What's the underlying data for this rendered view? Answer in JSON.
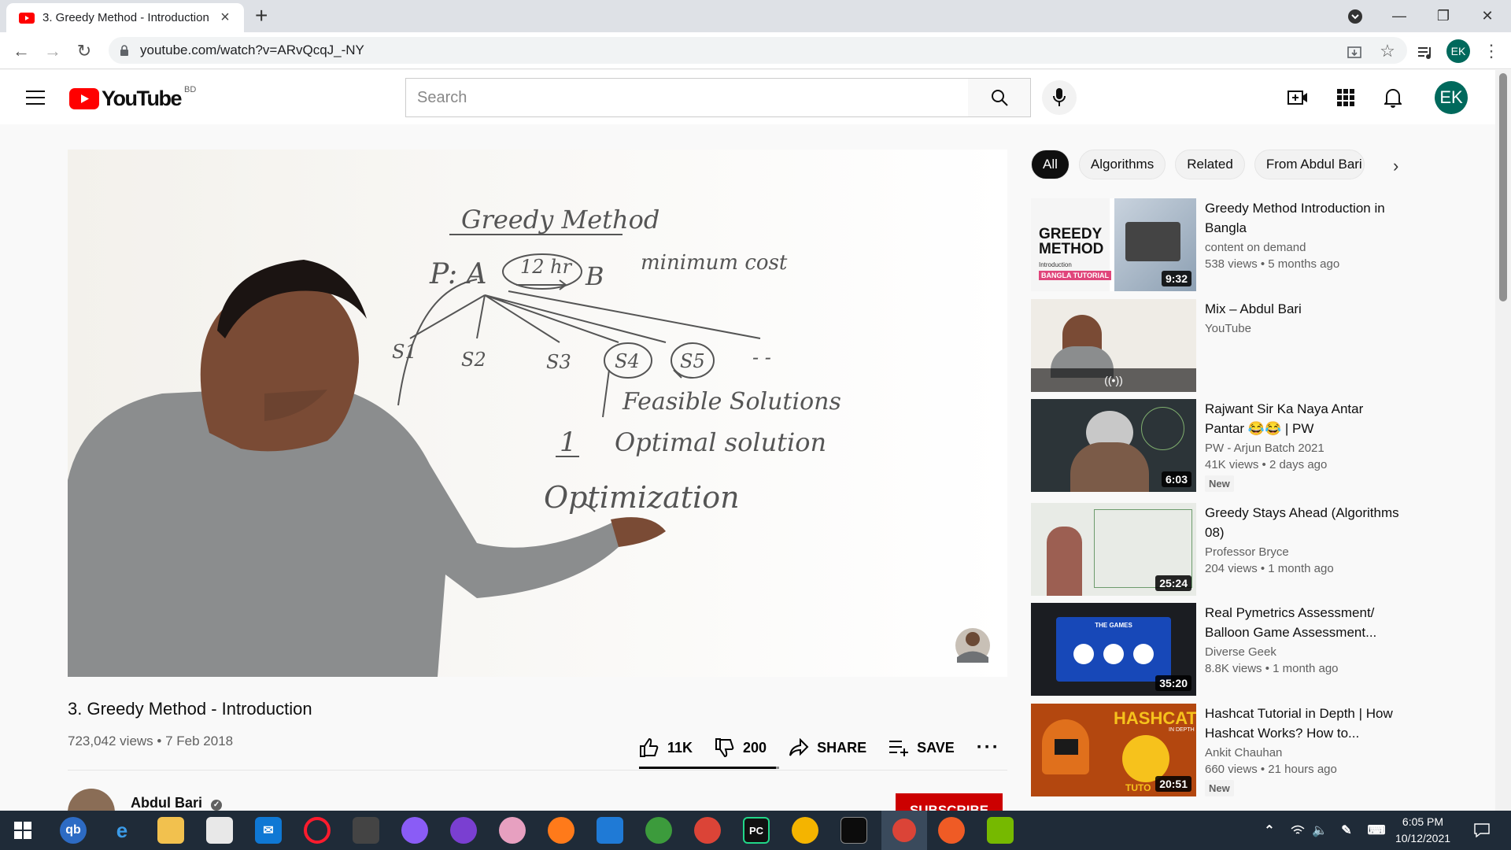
{
  "browser": {
    "tab_title": "3. Greedy Method - Introduction",
    "url": "youtube.com/watch?v=ARvQcqJ_-NY",
    "profile_initials": "EK"
  },
  "youtube": {
    "logo_text": "YouTube",
    "region": "BD",
    "search_placeholder": "Search",
    "avatar_initials": "EK"
  },
  "video": {
    "title": "3. Greedy Method - Introduction",
    "views": "723,042 views",
    "date": "7 Feb 2018",
    "likes": "11K",
    "dislikes": "200",
    "share_label": "SHARE",
    "save_label": "SAVE",
    "like_ratio": 0.98,
    "board": {
      "heading": "Greedy Method",
      "problem": "P: A",
      "time": "12 hr",
      "dest": "B",
      "criteria": "minimum cost",
      "s1": "S1",
      "s2": "S2",
      "s3": "S3",
      "s4": "S4",
      "s5": "S5",
      "dashes": "- -",
      "feasible": "Feasible Solutions",
      "one": "1",
      "optimal": "Optimal solution",
      "optimization": "Optimization"
    }
  },
  "channel": {
    "name": "Abdul Bari",
    "subscribe_label": "SUBSCRIBE"
  },
  "chips": [
    "All",
    "Algorithms",
    "Related",
    "From Abdul Bari"
  ],
  "recommendations": [
    {
      "title": "Greedy Method Introduction in Bangla",
      "channel": "content on demand",
      "meta": "538 views • 5 months ago",
      "duration": "9:32",
      "badge": "",
      "thumb_text": "GREEDY METHOD",
      "thumb_sub": "Introduction",
      "thumb_tag": "BANGLA TUTORIAL"
    },
    {
      "title": "Mix – Abdul Bari",
      "channel": "YouTube",
      "meta": "",
      "duration": "",
      "badge": "",
      "live_icon": "((•))"
    },
    {
      "title": "Rajwant Sir Ka Naya Antar Pantar 😂😂 | PW",
      "channel": "PW - Arjun Batch 2021",
      "meta": "41K views • 2 days ago",
      "duration": "6:03",
      "badge": "New"
    },
    {
      "title": "Greedy Stays Ahead (Algorithms 08)",
      "channel": "Professor Bryce",
      "meta": "204 views • 1 month ago",
      "duration": "25:24",
      "badge": ""
    },
    {
      "title": "Real Pymetrics Assessment/ Balloon Game Assessment...",
      "channel": "Diverse Geek",
      "meta": "8.8K views • 1 month ago",
      "duration": "35:20",
      "badge": "",
      "thumb_text": "THE GAMES"
    },
    {
      "title": "Hashcat Tutorial in Depth | How Hashcat Works? How to...",
      "channel": "Ankit Chauhan",
      "meta": "660 views • 21 hours ago",
      "duration": "20:51",
      "badge": "New",
      "thumb_text": "HASHCAT",
      "thumb_sub": "IN DEPTH",
      "thumb_tag": "TUTO"
    }
  ],
  "taskbar": {
    "time": "6:05 PM",
    "date": "10/12/2021",
    "icons": [
      "windows-start",
      "qbittorrent",
      "edge",
      "file-explorer",
      "store",
      "mail",
      "opera",
      "inkscape",
      "messenger",
      "github-desktop",
      "paint",
      "firefox",
      "vscode",
      "earth",
      "chrome-profile",
      "pycharm",
      "chrome",
      "terminal",
      "chrome-active",
      "postman",
      "nvidia"
    ]
  },
  "colors": {
    "youtube_red": "#ff0000",
    "subscribe_red": "#cc0000",
    "avatar_teal": "#00695c",
    "taskbar": "#1f2b38"
  }
}
